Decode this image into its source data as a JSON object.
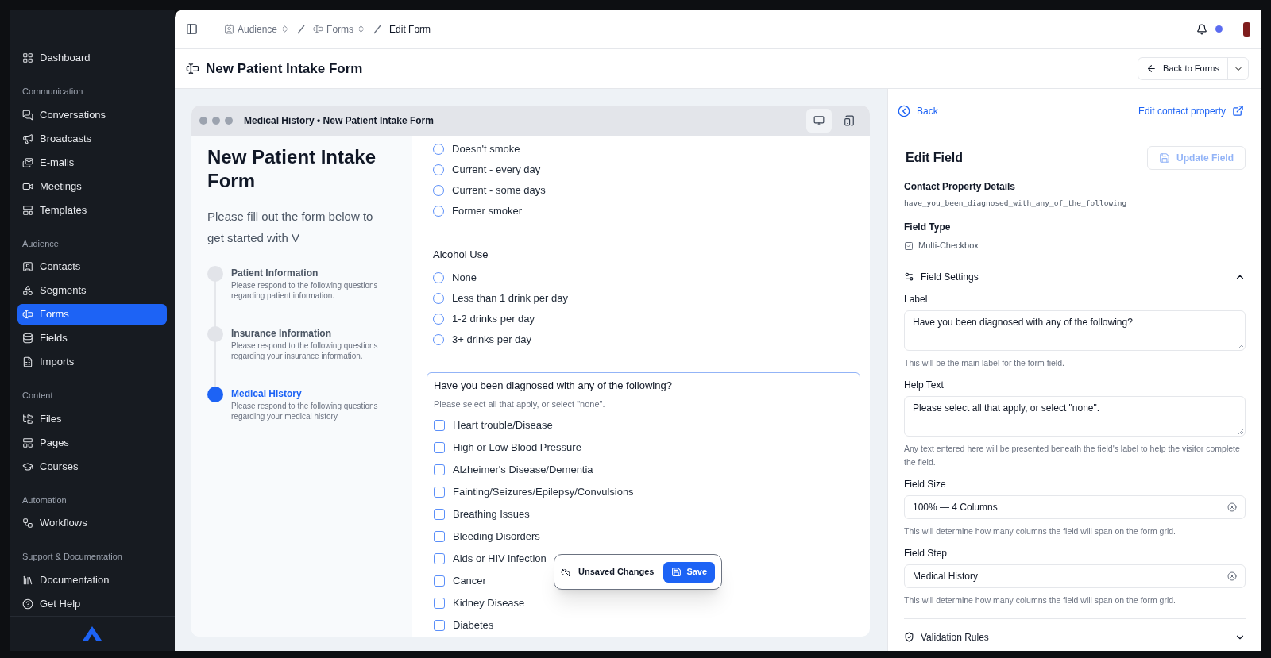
{
  "sidebar": {
    "sections": [
      {
        "items": [
          {
            "label": "Dashboard",
            "selected": false
          }
        ]
      },
      {
        "title": "Communication",
        "items": [
          {
            "label": "Conversations",
            "selected": false
          },
          {
            "label": "Broadcasts",
            "selected": false
          },
          {
            "label": "E-mails",
            "selected": false
          },
          {
            "label": "Meetings",
            "selected": false
          },
          {
            "label": "Templates",
            "selected": false
          }
        ]
      },
      {
        "title": "Audience",
        "items": [
          {
            "label": "Contacts",
            "selected": false
          },
          {
            "label": "Segments",
            "selected": false
          },
          {
            "label": "Forms",
            "selected": true
          },
          {
            "label": "Fields",
            "selected": false
          },
          {
            "label": "Imports",
            "selected": false
          }
        ]
      },
      {
        "title": "Content",
        "items": [
          {
            "label": "Files",
            "selected": false
          },
          {
            "label": "Pages",
            "selected": false
          },
          {
            "label": "Courses",
            "selected": false
          }
        ]
      },
      {
        "title": "Automation",
        "items": [
          {
            "label": "Workflows",
            "selected": false
          }
        ]
      },
      {
        "title": "Support & Documentation",
        "items": [
          {
            "label": "Documentation",
            "selected": false
          },
          {
            "label": "Get Help",
            "selected": false
          }
        ]
      }
    ]
  },
  "breadcrumbs": [
    {
      "label": "Audience",
      "menu": true
    },
    {
      "label": "Forms",
      "menu": true
    },
    {
      "label": "Edit Form",
      "menu": false
    }
  ],
  "header": {
    "title": "New Patient Intake Form",
    "back_button": "Back to Forms"
  },
  "preview": {
    "window_title": "Medical History • New Patient Intake Form",
    "view_modes": [
      {
        "selected": true
      },
      {
        "selected": false
      }
    ],
    "form_title": "New Patient Intake Form",
    "intro": "Please fill out the form below to get started with V",
    "steps": [
      {
        "title": "Patient Information",
        "description": "Please respond to the following questions regarding patient information.",
        "selected": false
      },
      {
        "title": "Insurance Information",
        "description": "Please respond to the following questions regarding your insurance information.",
        "selected": false
      },
      {
        "title": "Medical History",
        "description": "Please respond to the following questions regarding your medical history",
        "selected": true
      }
    ],
    "smoking_options": [
      {
        "label": "Doesn't smoke",
        "selected": false
      },
      {
        "label": "Current - every day",
        "selected": false
      },
      {
        "label": "Current - some days",
        "selected": false
      },
      {
        "label": "Former smoker",
        "selected": false
      }
    ],
    "alcohol": {
      "label": "Alcohol Use",
      "options": [
        {
          "label": "None",
          "selected": false
        },
        {
          "label": "Less than 1 drink per day",
          "selected": false
        },
        {
          "label": "1-2 drinks per day",
          "selected": false
        },
        {
          "label": "3+ drinks per day",
          "selected": false
        }
      ]
    },
    "diagnosis": {
      "selected": true,
      "label": "Have you been diagnosed with any of the following?",
      "help": "Please select all that apply, or select \"none\".",
      "options": [
        {
          "label": "Heart trouble/Disease",
          "checked": false
        },
        {
          "label": "High or Low Blood Pressure",
          "checked": false
        },
        {
          "label": "Alzheimer's Disease/Dementia",
          "checked": false
        },
        {
          "label": "Fainting/Seizures/Epilepsy/Convulsions",
          "checked": false
        },
        {
          "label": "Breathing Issues",
          "checked": false
        },
        {
          "label": "Bleeding Disorders",
          "checked": false
        },
        {
          "label": "Aids or HIV infection",
          "checked": false
        },
        {
          "label": "Cancer",
          "checked": false
        },
        {
          "label": "Kidney Disease",
          "checked": false
        },
        {
          "label": "Diabetes",
          "checked": false
        }
      ]
    },
    "unsaved": {
      "label": "Unsaved Changes",
      "button": "Save"
    }
  },
  "panel": {
    "back": "Back",
    "edit_link": "Edit contact property",
    "title": "Edit Field",
    "update_button": {
      "label": "Update Field",
      "disabled": true
    },
    "property_label": "Contact Property Details",
    "property_value": "have_you_been_diagnosed_with_any_of_the_following",
    "type_label": "Field Type",
    "type_value": "Multi-Checkbox",
    "settings": {
      "title": "Field Settings",
      "expanded": true
    },
    "fields": [
      {
        "kind": "textarea",
        "label": "Label",
        "value": "Have you been diagnosed with any of the following?",
        "help": "This will be the main label for the form field."
      },
      {
        "kind": "textarea",
        "label": "Help Text",
        "value": "Please select all that apply, or select \"none\".",
        "help": "Any text entered here will be presented beneath the field's label to help the visitor complete the field."
      },
      {
        "kind": "select",
        "label": "Field Size",
        "value": "100% — 4 Columns",
        "help": "This will determine how many columns the field will span on the form grid."
      },
      {
        "kind": "select",
        "label": "Field Step",
        "value": "Medical History",
        "help": "This will determine how many columns the field will span on the form grid."
      }
    ],
    "validation": {
      "title": "Validation Rules",
      "expanded": false
    }
  }
}
